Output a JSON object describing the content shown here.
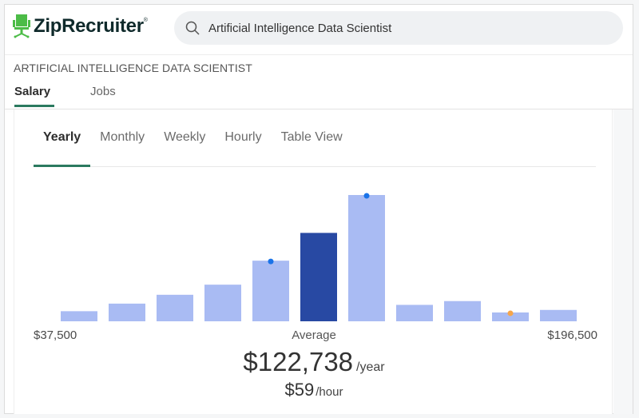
{
  "header": {
    "brand": "ZipRecruiter",
    "brand_mark": "®",
    "brand_color": "#4cbc47",
    "search": {
      "value": "Artificial Intelligence Data Scientist",
      "icon": "search-icon"
    }
  },
  "job_title": "ARTIFICIAL INTELLIGENCE DATA SCIENTIST",
  "subtabs": [
    {
      "label": "Salary",
      "active": true
    },
    {
      "label": "Jobs",
      "active": false
    }
  ],
  "period_tabs": [
    {
      "label": "Yearly",
      "active": true
    },
    {
      "label": "Monthly",
      "active": false
    },
    {
      "label": "Weekly",
      "active": false
    },
    {
      "label": "Hourly",
      "active": false
    },
    {
      "label": "Table View",
      "active": false
    }
  ],
  "accent_color": "#2b7a5f",
  "chart_data": {
    "type": "bar",
    "title": "",
    "xlabel": "",
    "ylabel": "",
    "description": "Salary distribution histogram, 11 buckets from $37,500 to $196,500; bar heights relative to tallest bucket (percent)",
    "x_range": [
      "$37,500",
      "$196,500"
    ],
    "categories": [
      "1",
      "2",
      "3",
      "4",
      "5",
      "6",
      "7",
      "8",
      "9",
      "10",
      "11"
    ],
    "values": [
      8,
      14,
      21,
      29,
      48,
      70,
      100,
      13,
      16,
      7,
      9
    ],
    "highlighted_index": 5,
    "markers": [
      {
        "index": 4,
        "color": "#1a73e8"
      },
      {
        "index": 6,
        "color": "#1a73e8"
      },
      {
        "index": 9,
        "color": "#f5a54a"
      }
    ],
    "colors": {
      "bar": "#a9bbf3",
      "highlight": "#2849a3"
    },
    "grid": false,
    "legend": "none"
  },
  "axis": {
    "min_label": "$37,500",
    "avg_label": "Average",
    "max_label": "$196,500"
  },
  "summary": {
    "yearly_amount": "$122,738",
    "yearly_unit": "/year",
    "hourly_amount": "$59",
    "hourly_unit": "/hour"
  }
}
